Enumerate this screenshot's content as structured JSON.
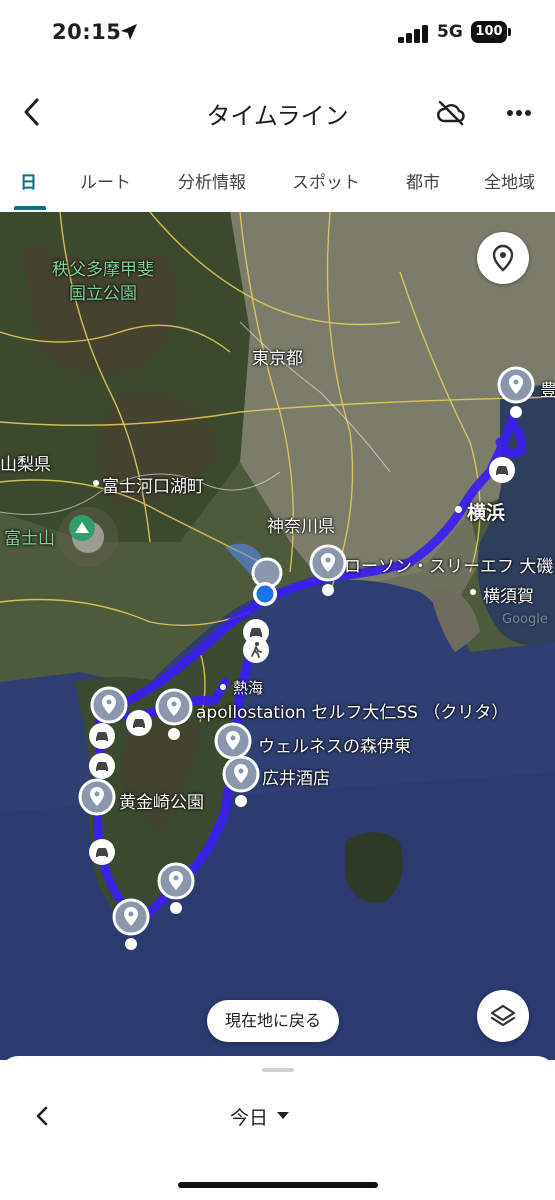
{
  "status_bar": {
    "time": "20:15",
    "network": "5G",
    "battery": "100"
  },
  "header": {
    "title": "タイムライン"
  },
  "tabs": [
    {
      "label": "日",
      "active": true
    },
    {
      "label": "ルート"
    },
    {
      "label": "分析情報"
    },
    {
      "label": "スポット"
    },
    {
      "label": "都市"
    },
    {
      "label": "全地域"
    }
  ],
  "map": {
    "labels": {
      "park_name": "秩父多摩甲斐\n国立公園",
      "tokyo": "東京都",
      "yamanashi": "山梨県",
      "fujikawaguchiko": "富士河口湖町",
      "fujisan": "富士山",
      "kanagawa": "神奈川県",
      "yokohama": "横浜",
      "yokosuka": "横須賀",
      "toyo_partial": "豊",
      "atami": "熱海",
      "lawson": "ローソン・スリーエフ 大磯",
      "apollostation": "apollostation セルフ大仁SS （クリタ）",
      "wellness": "ウェルネスの森伊東",
      "hiroi": "広井酒店",
      "koganezaki": "黄金崎公園",
      "google": "Google"
    },
    "return_button": "現在地に戻る",
    "colors": {
      "route": "#3a1ef0",
      "pin": "#8a97ad",
      "current": "#1a73e8"
    }
  },
  "bottom_sheet": {
    "date": "今日"
  }
}
